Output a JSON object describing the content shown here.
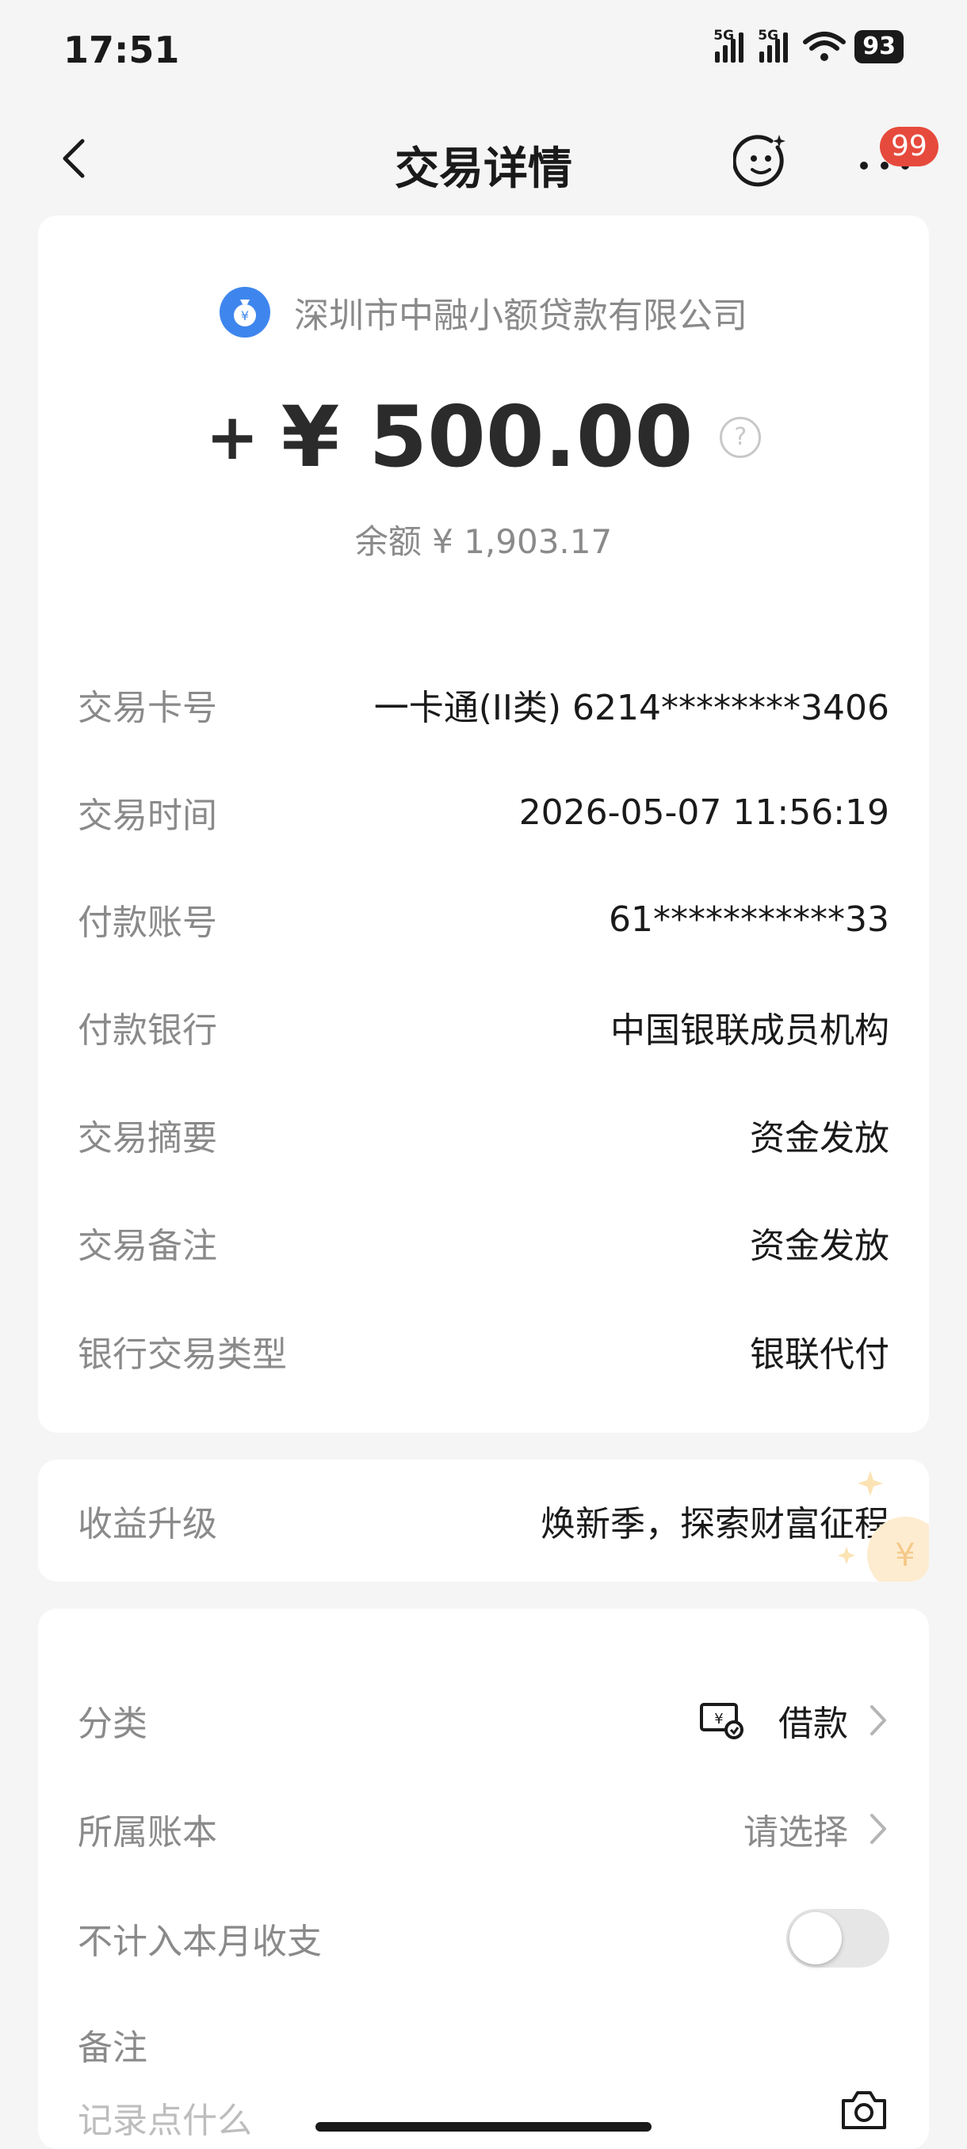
{
  "status_bar": {
    "time": "17:51",
    "sim1": "5G",
    "sim2": "5G",
    "battery": "93"
  },
  "header": {
    "title": "交易详情",
    "more_badge": "99"
  },
  "transaction": {
    "merchant_name": "深圳市中融小额贷款有限公司",
    "amount_sign": "+",
    "amount": "¥ 500.00",
    "balance": "余额 ¥ 1,903.17"
  },
  "details": [
    {
      "label": "交易卡号",
      "value": "一卡通(II类) 6214********3406"
    },
    {
      "label": "交易时间",
      "value": "2026-05-07 11:56:19"
    },
    {
      "label": "付款账号",
      "value": "61***********33"
    },
    {
      "label": "付款银行",
      "value": "中国银联成员机构"
    },
    {
      "label": "交易摘要",
      "value": "资金发放"
    },
    {
      "label": "交易备注",
      "value": "资金发放"
    },
    {
      "label": "银行交易类型",
      "value": "银联代付"
    }
  ],
  "promo": {
    "label": "收益升级",
    "value": "焕新季，探索财富征程"
  },
  "settings": {
    "category_label": "分类",
    "category_value": "借款",
    "ledger_label": "所属账本",
    "ledger_value": "请选择",
    "exclude_label": "不计入本月收支",
    "exclude_toggle": false,
    "note_label": "备注",
    "note_placeholder": "记录点什么"
  },
  "colors": {
    "accent_blue": "#3e86ee",
    "badge_red": "#e64a3c"
  }
}
